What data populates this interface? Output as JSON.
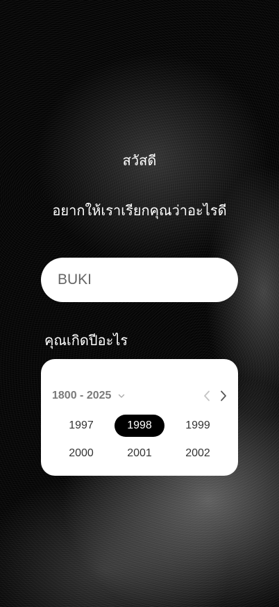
{
  "greeting": "สวัสดี",
  "name_question": "อยากให้เราเรียกคุณว่าอะไรดี",
  "name_input": {
    "value": "BUKI"
  },
  "birth_question": "คุณเกิดปีอะไร",
  "year_picker": {
    "range_label": "1800 - 2025",
    "selected_year": "1998",
    "years": [
      "1997",
      "1998",
      "1999",
      "2000",
      "2001",
      "2002"
    ],
    "icons": {
      "range_toggle": "chevron-down-icon",
      "prev": "chevron-left-icon",
      "next": "chevron-right-icon"
    }
  },
  "colors": {
    "background": "#050505",
    "card": "#ffffff",
    "selected_bg": "#000000",
    "selected_text": "#ffffff"
  }
}
